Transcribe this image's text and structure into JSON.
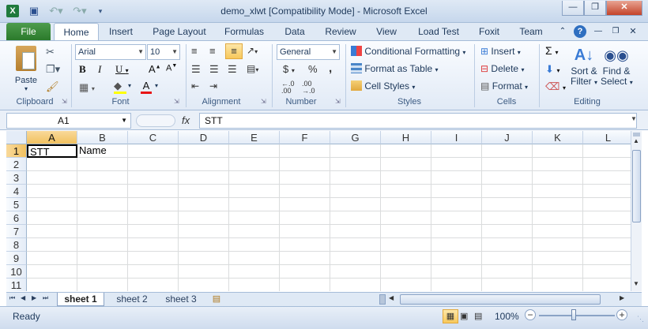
{
  "window": {
    "title": "demo_xlwt  [Compatibility Mode]  -  Microsoft Excel"
  },
  "tabs": [
    "File",
    "Home",
    "Insert",
    "Page Layout",
    "Formulas",
    "Data",
    "Review",
    "View",
    "Load Test",
    "Foxit",
    "Team"
  ],
  "ribbon": {
    "clipboard": {
      "paste": "Paste",
      "label": "Clipboard"
    },
    "font": {
      "name": "Arial",
      "size": "10",
      "label": "Font"
    },
    "alignment": {
      "label": "Alignment"
    },
    "number": {
      "format": "General",
      "label": "Number"
    },
    "styles": {
      "conditional": "Conditional Formatting",
      "format_table": "Format as Table",
      "cell_styles": "Cell Styles",
      "label": "Styles"
    },
    "cells": {
      "insert": "Insert",
      "delete": "Delete",
      "format": "Format",
      "label": "Cells"
    },
    "editing": {
      "sort1": "Sort &",
      "sort2": "Filter",
      "find1": "Find &",
      "find2": "Select",
      "label": "Editing"
    }
  },
  "formula_bar": {
    "name_box": "A1",
    "fx": "fx",
    "value": "STT"
  },
  "grid": {
    "columns": [
      "A",
      "B",
      "C",
      "D",
      "E",
      "F",
      "G",
      "H",
      "I",
      "J",
      "K",
      "L"
    ],
    "rows": [
      "1",
      "2",
      "3",
      "4",
      "5",
      "6",
      "7",
      "8",
      "9",
      "10",
      "11"
    ],
    "cells": {
      "A1": "STT",
      "B1": "Name"
    },
    "active_cell": "A1"
  },
  "sheets": [
    "sheet 1",
    "sheet 2",
    "sheet 3"
  ],
  "status": {
    "state": "Ready",
    "zoom": "100%"
  }
}
